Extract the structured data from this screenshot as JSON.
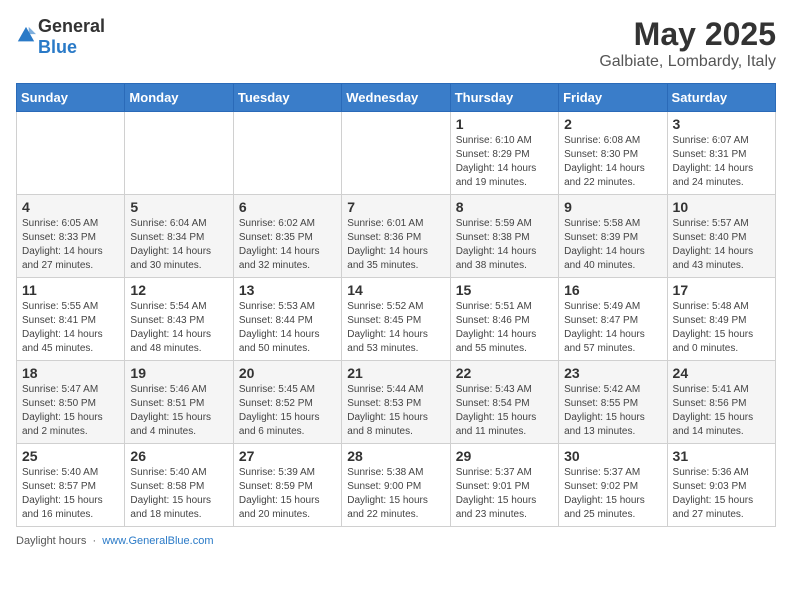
{
  "header": {
    "logo_general": "General",
    "logo_blue": "Blue",
    "month_title": "May 2025",
    "location": "Galbiate, Lombardy, Italy"
  },
  "weekdays": [
    "Sunday",
    "Monday",
    "Tuesday",
    "Wednesday",
    "Thursday",
    "Friday",
    "Saturday"
  ],
  "weeks": [
    [
      {
        "day": "",
        "info": ""
      },
      {
        "day": "",
        "info": ""
      },
      {
        "day": "",
        "info": ""
      },
      {
        "day": "",
        "info": ""
      },
      {
        "day": "1",
        "info": "Sunrise: 6:10 AM\nSunset: 8:29 PM\nDaylight: 14 hours\nand 19 minutes."
      },
      {
        "day": "2",
        "info": "Sunrise: 6:08 AM\nSunset: 8:30 PM\nDaylight: 14 hours\nand 22 minutes."
      },
      {
        "day": "3",
        "info": "Sunrise: 6:07 AM\nSunset: 8:31 PM\nDaylight: 14 hours\nand 24 minutes."
      }
    ],
    [
      {
        "day": "4",
        "info": "Sunrise: 6:05 AM\nSunset: 8:33 PM\nDaylight: 14 hours\nand 27 minutes."
      },
      {
        "day": "5",
        "info": "Sunrise: 6:04 AM\nSunset: 8:34 PM\nDaylight: 14 hours\nand 30 minutes."
      },
      {
        "day": "6",
        "info": "Sunrise: 6:02 AM\nSunset: 8:35 PM\nDaylight: 14 hours\nand 32 minutes."
      },
      {
        "day": "7",
        "info": "Sunrise: 6:01 AM\nSunset: 8:36 PM\nDaylight: 14 hours\nand 35 minutes."
      },
      {
        "day": "8",
        "info": "Sunrise: 5:59 AM\nSunset: 8:38 PM\nDaylight: 14 hours\nand 38 minutes."
      },
      {
        "day": "9",
        "info": "Sunrise: 5:58 AM\nSunset: 8:39 PM\nDaylight: 14 hours\nand 40 minutes."
      },
      {
        "day": "10",
        "info": "Sunrise: 5:57 AM\nSunset: 8:40 PM\nDaylight: 14 hours\nand 43 minutes."
      }
    ],
    [
      {
        "day": "11",
        "info": "Sunrise: 5:55 AM\nSunset: 8:41 PM\nDaylight: 14 hours\nand 45 minutes."
      },
      {
        "day": "12",
        "info": "Sunrise: 5:54 AM\nSunset: 8:43 PM\nDaylight: 14 hours\nand 48 minutes."
      },
      {
        "day": "13",
        "info": "Sunrise: 5:53 AM\nSunset: 8:44 PM\nDaylight: 14 hours\nand 50 minutes."
      },
      {
        "day": "14",
        "info": "Sunrise: 5:52 AM\nSunset: 8:45 PM\nDaylight: 14 hours\nand 53 minutes."
      },
      {
        "day": "15",
        "info": "Sunrise: 5:51 AM\nSunset: 8:46 PM\nDaylight: 14 hours\nand 55 minutes."
      },
      {
        "day": "16",
        "info": "Sunrise: 5:49 AM\nSunset: 8:47 PM\nDaylight: 14 hours\nand 57 minutes."
      },
      {
        "day": "17",
        "info": "Sunrise: 5:48 AM\nSunset: 8:49 PM\nDaylight: 15 hours\nand 0 minutes."
      }
    ],
    [
      {
        "day": "18",
        "info": "Sunrise: 5:47 AM\nSunset: 8:50 PM\nDaylight: 15 hours\nand 2 minutes."
      },
      {
        "day": "19",
        "info": "Sunrise: 5:46 AM\nSunset: 8:51 PM\nDaylight: 15 hours\nand 4 minutes."
      },
      {
        "day": "20",
        "info": "Sunrise: 5:45 AM\nSunset: 8:52 PM\nDaylight: 15 hours\nand 6 minutes."
      },
      {
        "day": "21",
        "info": "Sunrise: 5:44 AM\nSunset: 8:53 PM\nDaylight: 15 hours\nand 8 minutes."
      },
      {
        "day": "22",
        "info": "Sunrise: 5:43 AM\nSunset: 8:54 PM\nDaylight: 15 hours\nand 11 minutes."
      },
      {
        "day": "23",
        "info": "Sunrise: 5:42 AM\nSunset: 8:55 PM\nDaylight: 15 hours\nand 13 minutes."
      },
      {
        "day": "24",
        "info": "Sunrise: 5:41 AM\nSunset: 8:56 PM\nDaylight: 15 hours\nand 14 minutes."
      }
    ],
    [
      {
        "day": "25",
        "info": "Sunrise: 5:40 AM\nSunset: 8:57 PM\nDaylight: 15 hours\nand 16 minutes."
      },
      {
        "day": "26",
        "info": "Sunrise: 5:40 AM\nSunset: 8:58 PM\nDaylight: 15 hours\nand 18 minutes."
      },
      {
        "day": "27",
        "info": "Sunrise: 5:39 AM\nSunset: 8:59 PM\nDaylight: 15 hours\nand 20 minutes."
      },
      {
        "day": "28",
        "info": "Sunrise: 5:38 AM\nSunset: 9:00 PM\nDaylight: 15 hours\nand 22 minutes."
      },
      {
        "day": "29",
        "info": "Sunrise: 5:37 AM\nSunset: 9:01 PM\nDaylight: 15 hours\nand 23 minutes."
      },
      {
        "day": "30",
        "info": "Sunrise: 5:37 AM\nSunset: 9:02 PM\nDaylight: 15 hours\nand 25 minutes."
      },
      {
        "day": "31",
        "info": "Sunrise: 5:36 AM\nSunset: 9:03 PM\nDaylight: 15 hours\nand 27 minutes."
      }
    ]
  ],
  "footer": {
    "text": "Daylight hours",
    "site": "www.GeneralBlue.com"
  }
}
